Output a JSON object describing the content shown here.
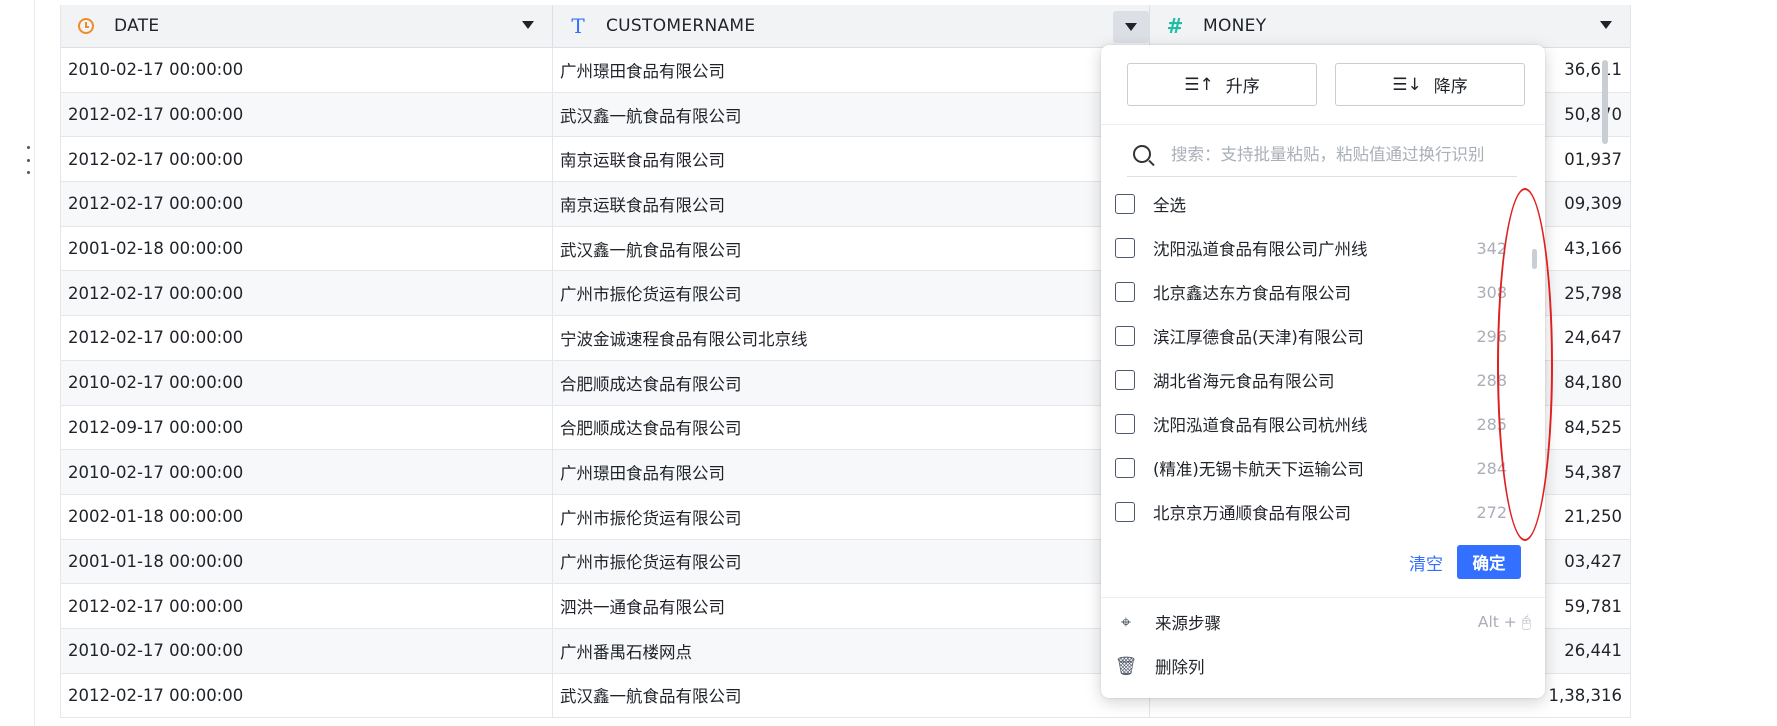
{
  "columns": [
    {
      "name": "DATE",
      "type_icon": "clock-icon"
    },
    {
      "name": "CUSTOMERNAME",
      "type_icon": "text-type-icon"
    },
    {
      "name": "MONEY",
      "type_icon": "hash-icon"
    }
  ],
  "rows": [
    {
      "date": "2010-02-17 00:00:00",
      "customer": "广州璟田食品有限公司",
      "money": "36,611"
    },
    {
      "date": "2012-02-17 00:00:00",
      "customer": "武汉鑫一航食品有限公司",
      "money": "50,870"
    },
    {
      "date": "2012-02-17 00:00:00",
      "customer": "南京运联食品有限公司",
      "money": "01,937"
    },
    {
      "date": "2012-02-17 00:00:00",
      "customer": "南京运联食品有限公司",
      "money": "09,309"
    },
    {
      "date": "2001-02-18 00:00:00",
      "customer": "武汉鑫一航食品有限公司",
      "money": "43,166"
    },
    {
      "date": "2012-02-17 00:00:00",
      "customer": "广州市振伦货运有限公司",
      "money": "25,798"
    },
    {
      "date": "2012-02-17 00:00:00",
      "customer": "宁波金诚速程食品有限公司北京线",
      "money": "24,647"
    },
    {
      "date": "2010-02-17 00:00:00",
      "customer": "合肥顺成达食品有限公司",
      "money": "84,180"
    },
    {
      "date": "2012-09-17 00:00:00",
      "customer": "合肥顺成达食品有限公司",
      "money": "84,525"
    },
    {
      "date": "2010-02-17 00:00:00",
      "customer": "广州璟田食品有限公司",
      "money": "54,387"
    },
    {
      "date": "2002-01-18 00:00:00",
      "customer": "广州市振伦货运有限公司",
      "money": "21,250"
    },
    {
      "date": "2001-01-18 00:00:00",
      "customer": "广州市振伦货运有限公司",
      "money": "03,427"
    },
    {
      "date": "2012-02-17 00:00:00",
      "customer": "泗洪一通食品有限公司",
      "money": "59,781"
    },
    {
      "date": "2010-02-17 00:00:00",
      "customer": "广州番禺石楼网点",
      "money": "26,441"
    },
    {
      "date": "2012-02-17 00:00:00",
      "customer": "武汉鑫一航食品有限公司",
      "money": "1,38,316"
    }
  ],
  "filter_popup": {
    "sort_asc": "升序",
    "sort_desc": "降序",
    "search_placeholder": "搜索：支持批量粘贴，粘贴值通过换行识别",
    "select_all": "全选",
    "values": [
      {
        "label": "沈阳泓道食品有限公司广州线",
        "count": "342"
      },
      {
        "label": "北京鑫达东方食品有限公司",
        "count": "308"
      },
      {
        "label": "滨江厚德食品(天津)有限公司",
        "count": "296"
      },
      {
        "label": "湖北省海元食品有限公司",
        "count": "288"
      },
      {
        "label": "沈阳泓道食品有限公司杭州线",
        "count": "285"
      },
      {
        "label": "(精准)无锡卡航天下运输公司",
        "count": "284"
      },
      {
        "label": "北京京万通顺食品有限公司",
        "count": "272"
      }
    ],
    "clear": "清空",
    "confirm": "确定",
    "source_step": "来源步骤",
    "source_shortcut": "Alt +",
    "delete_column": "删除列"
  },
  "colors": {
    "accent": "#3370ff",
    "date_icon": "#f08c28",
    "number_icon": "#1fbda5",
    "annotation": "#e02020"
  }
}
